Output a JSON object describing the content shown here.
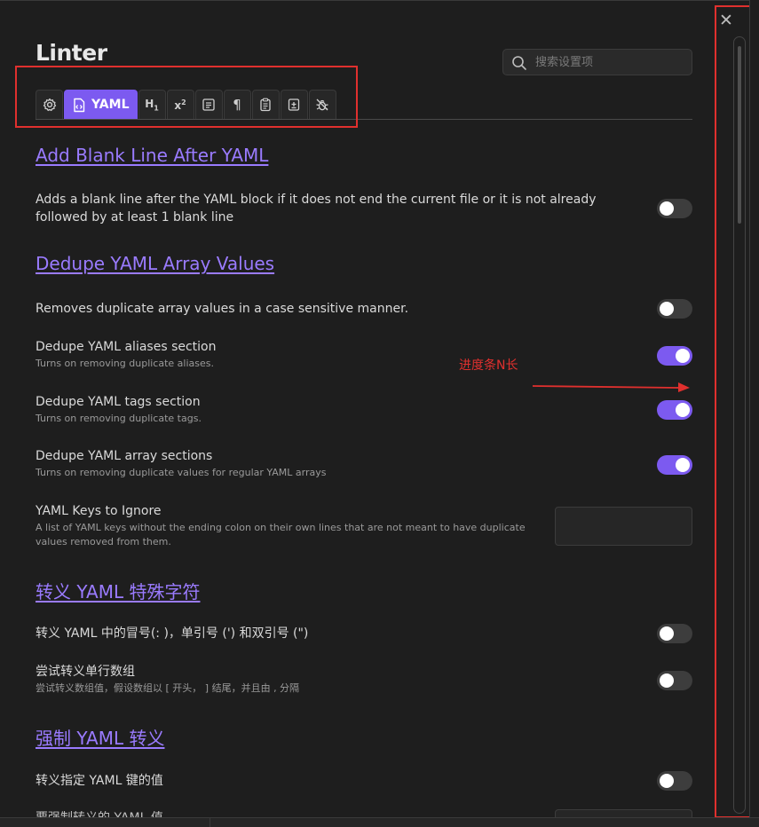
{
  "header": {
    "title": "Linter"
  },
  "search": {
    "placeholder": "搜索设置项"
  },
  "tabs": [
    {
      "icon": "gear-icon"
    },
    {
      "icon": "yaml-file-icon",
      "label": "YAML",
      "active": true
    },
    {
      "icon": "heading-icon"
    },
    {
      "icon": "superscript-icon"
    },
    {
      "icon": "align-icon"
    },
    {
      "icon": "pilcrow-icon"
    },
    {
      "icon": "clipboard-icon"
    },
    {
      "icon": "add-file-icon"
    },
    {
      "icon": "bug-off-icon"
    }
  ],
  "sections": [
    {
      "heading": "Add Blank Line After YAML"
    },
    {
      "heading": "Dedupe YAML Array Values"
    },
    {
      "heading": "转义 YAML 特殊字符"
    },
    {
      "heading": "强制 YAML 转义"
    }
  ],
  "settings": [
    {
      "name": "Adds a blank line after the YAML block if it does not end the current file or it is not already followed by at least 1 blank line",
      "desc": "",
      "on": false
    },
    {
      "name": "Removes duplicate array values in a case sensitive manner.",
      "desc": "",
      "on": false
    },
    {
      "name": "Dedupe YAML aliases section",
      "desc": "Turns on removing duplicate aliases.",
      "on": true
    },
    {
      "name": "Dedupe YAML tags section",
      "desc": "Turns on removing duplicate tags.",
      "on": true
    },
    {
      "name": "Dedupe YAML array sections",
      "desc": "Turns on removing duplicate values for regular YAML arrays",
      "on": true
    },
    {
      "name": "YAML Keys to Ignore",
      "desc": "A list of YAML keys without the ending colon on their own lines that are not meant to have duplicate values removed from them.",
      "value": ""
    },
    {
      "name": "转义 YAML 中的冒号(: )，单引号 (') 和双引号 (\")",
      "desc": "",
      "on": false
    },
    {
      "name": "尝试转义单行数组",
      "desc": "尝试转义数组值，假设数组以 [ 开头， ] 结尾，并且由 , 分隔",
      "on": false
    },
    {
      "name": "转义指定 YAML 键的值",
      "desc": "",
      "on": false
    },
    {
      "name": "要强制转义的 YAML 值",
      "desc": ""
    }
  ],
  "annotation": {
    "text": "进度条N长"
  },
  "colors": {
    "accent": "#7c5af0",
    "heading": "#9a7bff",
    "annotation": "#e0302e",
    "background": "#1e1e1e"
  },
  "close": {
    "icon": "close-icon",
    "glyph": "✕"
  }
}
